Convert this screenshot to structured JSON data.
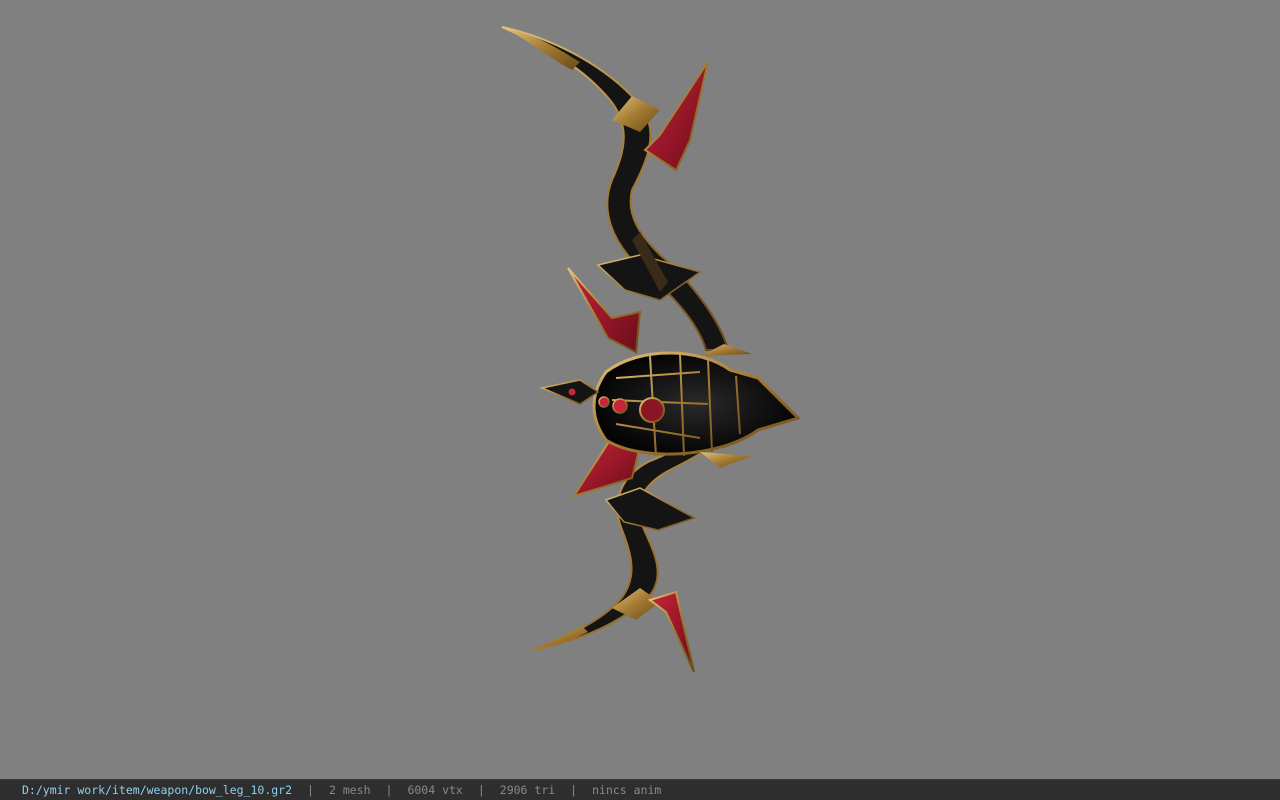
{
  "viewport": {
    "background": "#808080",
    "model_name": "bow_leg_10"
  },
  "status_bar": {
    "file_path": "D:/ymir work/item/weapon/bow_leg_10.gr2",
    "separator": "|",
    "mesh_count": "2 mesh",
    "vertex_count": "6004 vtx",
    "triangle_count": "2906 tri",
    "anim_status": "nincs anim"
  },
  "colors": {
    "path_text": "#8fd0ee",
    "stat_text": "#8a8a8a",
    "bar_background": "#2e2e2e",
    "bow_black": "#141414",
    "bow_gold": "#b8944a",
    "bow_red": "#a0182a"
  }
}
